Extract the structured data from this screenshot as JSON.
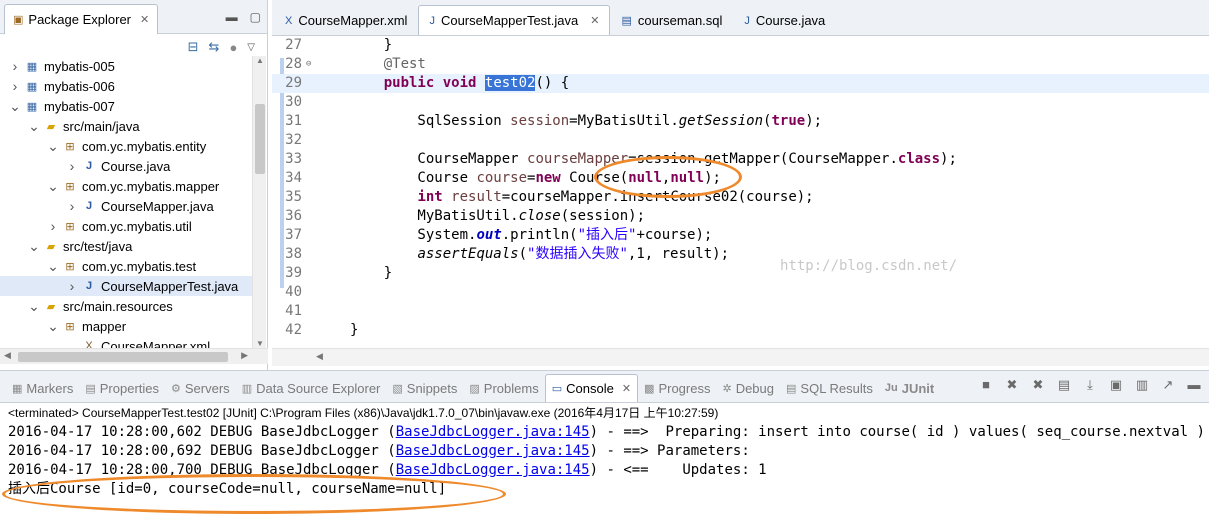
{
  "package_explorer": {
    "tab_label": "Package Explorer",
    "tree": [
      {
        "label": "mybatis-005",
        "indent": 0,
        "twisty": "right",
        "icon": "project-icon"
      },
      {
        "label": "mybatis-006",
        "indent": 0,
        "twisty": "right",
        "icon": "project-icon"
      },
      {
        "label": "mybatis-007",
        "indent": 0,
        "twisty": "down",
        "icon": "project-icon"
      },
      {
        "label": "src/main/java",
        "indent": 1,
        "twisty": "down",
        "icon": "source-folder-icon"
      },
      {
        "label": "com.yc.mybatis.entity",
        "indent": 2,
        "twisty": "down",
        "icon": "package-icon"
      },
      {
        "label": "Course.java",
        "indent": 3,
        "twisty": "right",
        "icon": "java-file-icon"
      },
      {
        "label": "com.yc.mybatis.mapper",
        "indent": 2,
        "twisty": "down",
        "icon": "package-icon"
      },
      {
        "label": "CourseMapper.java",
        "indent": 3,
        "twisty": "right",
        "icon": "java-file-icon"
      },
      {
        "label": "com.yc.mybatis.util",
        "indent": 2,
        "twisty": "right",
        "icon": "package-icon"
      },
      {
        "label": "src/test/java",
        "indent": 1,
        "twisty": "down",
        "icon": "source-folder-icon"
      },
      {
        "label": "com.yc.mybatis.test",
        "indent": 2,
        "twisty": "down",
        "icon": "package-icon"
      },
      {
        "label": "CourseMapperTest.java",
        "indent": 3,
        "twisty": "right",
        "icon": "java-file-icon",
        "selected": true
      },
      {
        "label": "src/main.resources",
        "indent": 1,
        "twisty": "down",
        "icon": "source-folder-icon"
      },
      {
        "label": "mapper",
        "indent": 2,
        "twisty": "down",
        "icon": "package-icon"
      },
      {
        "label": "CourseMapper.xml",
        "indent": 3,
        "twisty": "",
        "icon": "xml-file-icon"
      }
    ]
  },
  "editor": {
    "tabs": [
      {
        "label": "CourseMapper.xml",
        "icon": "xml-file-icon",
        "active": false
      },
      {
        "label": "CourseMapperTest.java",
        "icon": "java-file-icon",
        "active": true
      },
      {
        "label": "courseman.sql",
        "icon": "sql-file-icon",
        "active": false
      },
      {
        "label": "Course.java",
        "icon": "java-file-icon",
        "active": false
      }
    ],
    "lines": [
      {
        "n": "27",
        "tokens": [
          {
            "t": "    }",
            "c": ""
          }
        ]
      },
      {
        "n": "28",
        "fold": true,
        "tokens": [
          {
            "t": "    @Test",
            "c": "ann"
          }
        ]
      },
      {
        "n": "29",
        "hl": true,
        "tokens": [
          {
            "t": "    ",
            "c": ""
          },
          {
            "t": "public",
            "c": "kw"
          },
          {
            "t": " ",
            "c": ""
          },
          {
            "t": "void",
            "c": "kw"
          },
          {
            "t": " ",
            "c": ""
          },
          {
            "t": "test02",
            "c": "selword"
          },
          {
            "t": "() {",
            "c": ""
          }
        ]
      },
      {
        "n": "30",
        "tokens": [
          {
            "t": "",
            "c": ""
          }
        ]
      },
      {
        "n": "31",
        "tokens": [
          {
            "t": "        SqlSession ",
            "c": ""
          },
          {
            "t": "session",
            "c": "var"
          },
          {
            "t": "=MyBatisUtil.",
            "c": ""
          },
          {
            "t": "getSession",
            "c": "it"
          },
          {
            "t": "(",
            "c": ""
          },
          {
            "t": "true",
            "c": "kw"
          },
          {
            "t": ");",
            "c": ""
          }
        ]
      },
      {
        "n": "32",
        "tokens": [
          {
            "t": "",
            "c": ""
          }
        ]
      },
      {
        "n": "33",
        "tokens": [
          {
            "t": "        CourseMapper ",
            "c": ""
          },
          {
            "t": "courseMapper",
            "c": "var"
          },
          {
            "t": "=session.getMapper(CourseMapper.",
            "c": ""
          },
          {
            "t": "class",
            "c": "kw"
          },
          {
            "t": ");",
            "c": ""
          }
        ]
      },
      {
        "n": "34",
        "tokens": [
          {
            "t": "        Course ",
            "c": ""
          },
          {
            "t": "course",
            "c": "var"
          },
          {
            "t": "=",
            "c": ""
          },
          {
            "t": "new",
            "c": "kw"
          },
          {
            "t": " Course(",
            "c": ""
          },
          {
            "t": "null",
            "c": "kw"
          },
          {
            "t": ",",
            "c": ""
          },
          {
            "t": "null",
            "c": "kw"
          },
          {
            "t": ");",
            "c": ""
          }
        ]
      },
      {
        "n": "35",
        "tokens": [
          {
            "t": "        ",
            "c": ""
          },
          {
            "t": "int",
            "c": "kw"
          },
          {
            "t": " ",
            "c": ""
          },
          {
            "t": "result",
            "c": "var"
          },
          {
            "t": "=courseMapper.insertCourse02(course);",
            "c": ""
          }
        ]
      },
      {
        "n": "36",
        "tokens": [
          {
            "t": "        MyBatisUtil.",
            "c": ""
          },
          {
            "t": "close",
            "c": "it"
          },
          {
            "t": "(session);",
            "c": ""
          }
        ]
      },
      {
        "n": "37",
        "tokens": [
          {
            "t": "        System.",
            "c": ""
          },
          {
            "t": "out",
            "c": "fld"
          },
          {
            "t": ".println(",
            "c": ""
          },
          {
            "t": "\"插入后\"",
            "c": "str"
          },
          {
            "t": "+course);",
            "c": ""
          }
        ]
      },
      {
        "n": "38",
        "tokens": [
          {
            "t": "        ",
            "c": ""
          },
          {
            "t": "assertEquals",
            "c": "it"
          },
          {
            "t": "(",
            "c": ""
          },
          {
            "t": "\"数据插入失败\"",
            "c": "str"
          },
          {
            "t": ",1, result);",
            "c": ""
          }
        ]
      },
      {
        "n": "39",
        "tokens": [
          {
            "t": "    }",
            "c": ""
          }
        ]
      },
      {
        "n": "40",
        "tokens": [
          {
            "t": "",
            "c": ""
          }
        ]
      },
      {
        "n": "41",
        "tokens": [
          {
            "t": "",
            "c": ""
          }
        ]
      },
      {
        "n": "42",
        "tokens": [
          {
            "t": "}",
            "c": ""
          }
        ]
      },
      {
        "n": "",
        "tokens": [
          {
            "t": "",
            "c": ""
          }
        ]
      }
    ],
    "watermark": "http://blog.csdn.net/"
  },
  "bottom_panel": {
    "tabs": [
      {
        "label": "Markers",
        "icon": "markers-icon",
        "active": false
      },
      {
        "label": "Properties",
        "icon": "properties-icon",
        "active": false
      },
      {
        "label": "Servers",
        "icon": "servers-icon",
        "active": false
      },
      {
        "label": "Data Source Explorer",
        "icon": "data-source-icon",
        "active": false
      },
      {
        "label": "Snippets",
        "icon": "snippets-icon",
        "active": false
      },
      {
        "label": "Problems",
        "icon": "problems-icon",
        "active": false
      },
      {
        "label": "Console",
        "icon": "console-icon",
        "active": true
      },
      {
        "label": "Progress",
        "icon": "progress-icon",
        "active": false
      },
      {
        "label": "Debug",
        "icon": "debug-icon",
        "active": false
      },
      {
        "label": "SQL Results",
        "icon": "sql-results-icon",
        "active": false
      },
      {
        "label": "JUnit",
        "icon": "junit-icon",
        "active": false
      }
    ],
    "terminated": "<terminated> CourseMapperTest.test02 [JUnit] C:\\Program Files (x86)\\Java\\jdk1.7.0_07\\bin\\javaw.exe (2016年4月17日 上午10:27:59)",
    "console_lines": [
      {
        "pre": "2016-04-17 10:28:00,602 DEBUG BaseJdbcLogger (",
        "link": "BaseJdbcLogger.java:145",
        "post": ") - ==>  Preparing: insert into course( id ) values( seq_course.nextval )"
      },
      {
        "pre": "2016-04-17 10:28:00,692 DEBUG BaseJdbcLogger (",
        "link": "BaseJdbcLogger.java:145",
        "post": ") - ==> Parameters: "
      },
      {
        "pre": "2016-04-17 10:28:00,700 DEBUG BaseJdbcLogger (",
        "link": "BaseJdbcLogger.java:145",
        "post": ") - <==    Updates: 1"
      },
      {
        "pre": "插入后Course [id=0, courseCode=null, courseName=null]",
        "link": "",
        "post": ""
      }
    ]
  }
}
